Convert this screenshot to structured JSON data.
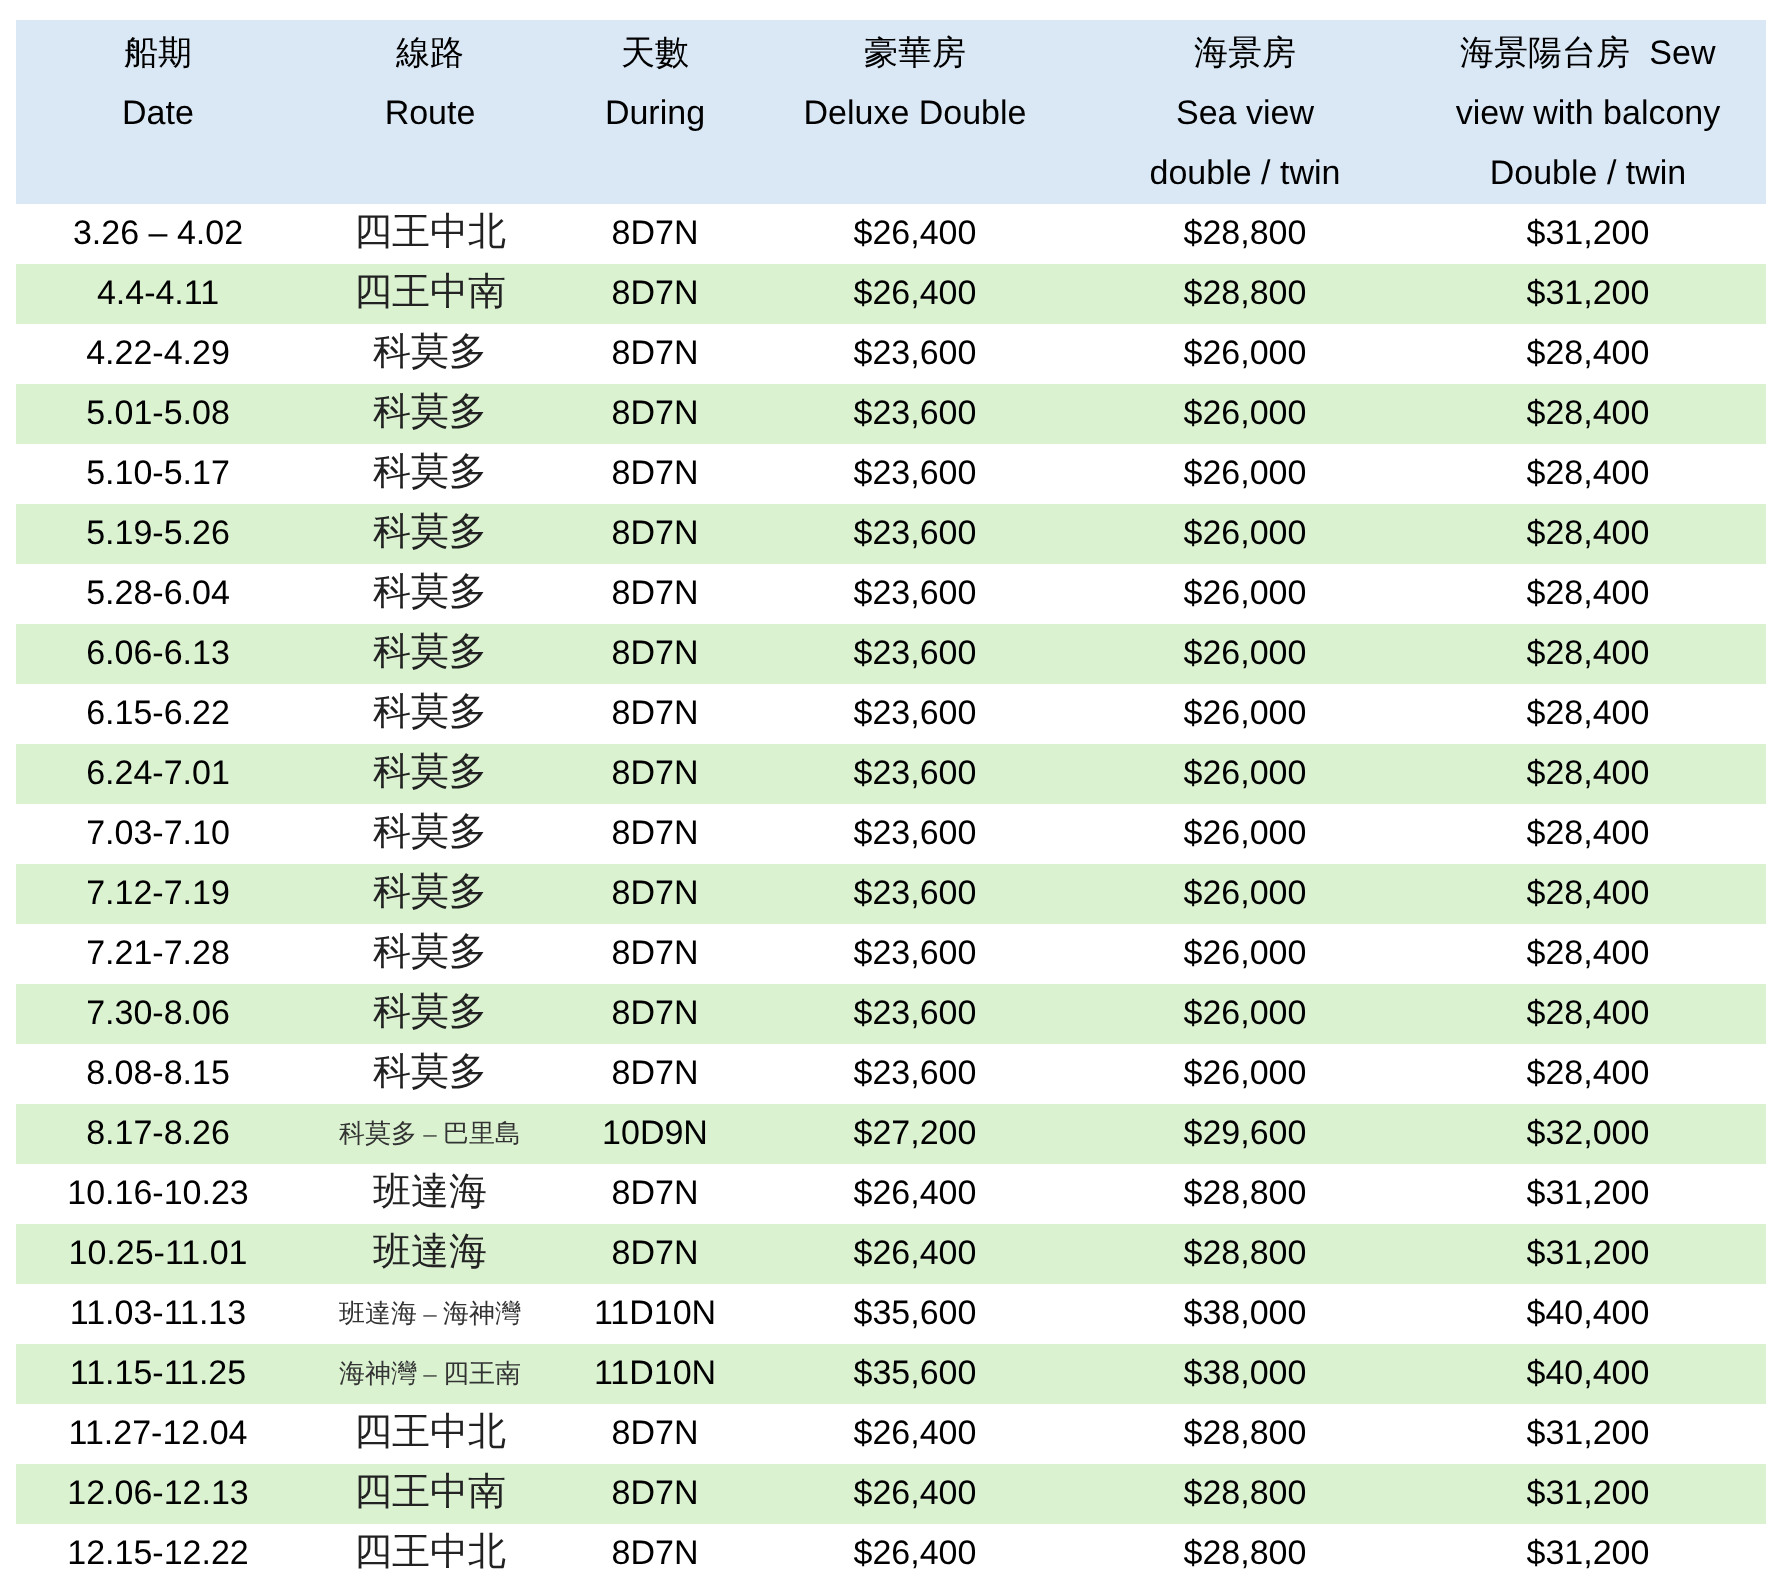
{
  "table": {
    "columns": [
      {
        "lines": [
          "船期",
          "Date"
        ]
      },
      {
        "lines": [
          "線路",
          "Route"
        ]
      },
      {
        "lines": [
          "天數",
          "During"
        ]
      },
      {
        "lines": [
          "豪華房",
          "Deluxe Double"
        ]
      },
      {
        "lines": [
          "海景房",
          "Sea view",
          "double / twin"
        ]
      },
      {
        "lines": [
          "海景陽台房  Sew",
          "view with balcony",
          "Double / twin"
        ]
      }
    ],
    "rows": [
      {
        "kind": "single",
        "date": "3.26 – 4.02",
        "route": "四王中北",
        "days": "8D7N",
        "deluxe": "$26,400",
        "sea_view": "$28,800",
        "balcony": "$31,200"
      },
      {
        "kind": "single",
        "date": "4.4-4.11",
        "route": "四王中南",
        "days": "8D7N",
        "deluxe": "$26,400",
        "sea_view": "$28,800",
        "balcony": "$31,200"
      },
      {
        "kind": "single",
        "date": "4.22-4.29",
        "route": "科莫多",
        "days": "8D7N",
        "deluxe": "$23,600",
        "sea_view": "$26,000",
        "balcony": "$28,400"
      },
      {
        "kind": "single",
        "date": "5.01-5.08",
        "route": "科莫多",
        "days": "8D7N",
        "deluxe": "$23,600",
        "sea_view": "$26,000",
        "balcony": "$28,400"
      },
      {
        "kind": "single",
        "date": "5.10-5.17",
        "route": "科莫多",
        "days": "8D7N",
        "deluxe": "$23,600",
        "sea_view": "$26,000",
        "balcony": "$28,400"
      },
      {
        "kind": "single",
        "date": "5.19-5.26",
        "route": "科莫多",
        "days": "8D7N",
        "deluxe": "$23,600",
        "sea_view": "$26,000",
        "balcony": "$28,400"
      },
      {
        "kind": "single",
        "date": "5.28-6.04",
        "route": "科莫多",
        "days": "8D7N",
        "deluxe": "$23,600",
        "sea_view": "$26,000",
        "balcony": "$28,400"
      },
      {
        "kind": "single",
        "date": "6.06-6.13",
        "route": "科莫多",
        "days": "8D7N",
        "deluxe": "$23,600",
        "sea_view": "$26,000",
        "balcony": "$28,400"
      },
      {
        "kind": "single",
        "date": "6.15-6.22",
        "route": "科莫多",
        "days": "8D7N",
        "deluxe": "$23,600",
        "sea_view": "$26,000",
        "balcony": "$28,400"
      },
      {
        "kind": "single",
        "date": "6.24-7.01",
        "route": "科莫多",
        "days": "8D7N",
        "deluxe": "$23,600",
        "sea_view": "$26,000",
        "balcony": "$28,400"
      },
      {
        "kind": "single",
        "date": "7.03-7.10",
        "route": "科莫多",
        "days": "8D7N",
        "deluxe": "$23,600",
        "sea_view": "$26,000",
        "balcony": "$28,400"
      },
      {
        "kind": "single",
        "date": "7.12-7.19",
        "route": "科莫多",
        "days": "8D7N",
        "deluxe": "$23,600",
        "sea_view": "$26,000",
        "balcony": "$28,400"
      },
      {
        "kind": "single",
        "date": "7.21-7.28",
        "route": "科莫多",
        "days": "8D7N",
        "deluxe": "$23,600",
        "sea_view": "$26,000",
        "balcony": "$28,400"
      },
      {
        "kind": "single",
        "date": "7.30-8.06",
        "route": "科莫多",
        "days": "8D7N",
        "deluxe": "$23,600",
        "sea_view": "$26,000",
        "balcony": "$28,400"
      },
      {
        "kind": "single",
        "date": "8.08-8.15",
        "route": "科莫多",
        "days": "8D7N",
        "deluxe": "$23,600",
        "sea_view": "$26,000",
        "balcony": "$28,400"
      },
      {
        "kind": "combined",
        "date": "8.17-8.26",
        "route": "科莫多 – 巴里島",
        "days": "10D9N",
        "deluxe": "$27,200",
        "sea_view": "$29,600",
        "balcony": "$32,000"
      },
      {
        "kind": "single",
        "date": "10.16-10.23",
        "route": "班達海",
        "days": "8D7N",
        "deluxe": "$26,400",
        "sea_view": "$28,800",
        "balcony": "$31,200"
      },
      {
        "kind": "single",
        "date": "10.25-11.01",
        "route": "班達海",
        "days": "8D7N",
        "deluxe": "$26,400",
        "sea_view": "$28,800",
        "balcony": "$31,200"
      },
      {
        "kind": "combined",
        "date": "11.03-11.13",
        "route": "班達海 – 海神灣",
        "days": "11D10N",
        "deluxe": "$35,600",
        "sea_view": "$38,000",
        "balcony": "$40,400"
      },
      {
        "kind": "combined",
        "date": "11.15-11.25",
        "route": "海神灣 – 四王南",
        "days": "11D10N",
        "deluxe": "$35,600",
        "sea_view": "$38,000",
        "balcony": "$40,400"
      },
      {
        "kind": "single",
        "date": "11.27-12.04",
        "route": "四王中北",
        "days": "8D7N",
        "deluxe": "$26,400",
        "sea_view": "$28,800",
        "balcony": "$31,200"
      },
      {
        "kind": "single",
        "date": "12.06-12.13",
        "route": "四王中南",
        "days": "8D7N",
        "deluxe": "$26,400",
        "sea_view": "$28,800",
        "balcony": "$31,200"
      },
      {
        "kind": "single",
        "date": "12.15-12.22",
        "route": "四王中北",
        "days": "8D7N",
        "deluxe": "$26,400",
        "sea_view": "$28,800",
        "balcony": "$31,200"
      }
    ]
  }
}
